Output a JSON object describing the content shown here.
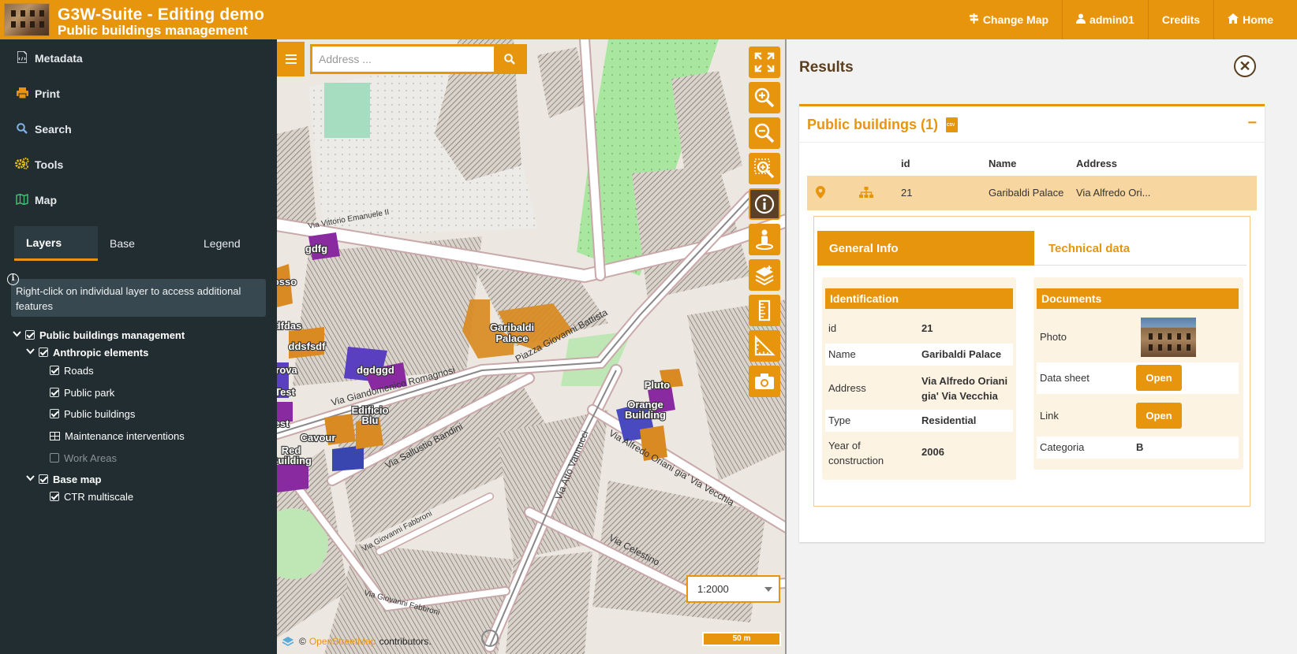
{
  "header": {
    "title": "G3W-Suite - Editing demo",
    "subtitle": "Public buildings management",
    "nav": [
      {
        "label": "Change Map",
        "icon": "signpost-icon"
      },
      {
        "label": "admin01",
        "icon": "user-icon"
      },
      {
        "label": "Credits",
        "icon": ""
      },
      {
        "label": "Home",
        "icon": "home-icon"
      }
    ]
  },
  "sidebar": {
    "menu": [
      {
        "label": "Metadata",
        "icon": "file-code-icon"
      },
      {
        "label": "Print",
        "icon": "print-icon"
      },
      {
        "label": "Search",
        "icon": "search-icon"
      },
      {
        "label": "Tools",
        "icon": "cogs-icon"
      },
      {
        "label": "Map",
        "icon": "map-icon"
      }
    ],
    "tabs": [
      "Layers",
      "Base",
      "Legend"
    ],
    "active_tab": "Layers",
    "info": "Right-click on individual layer to access additional features",
    "tree": [
      {
        "label": "Public buildings management",
        "level": 0,
        "group": true,
        "checked": true
      },
      {
        "label": "Anthropic elements",
        "level": 1,
        "group": true,
        "checked": true
      },
      {
        "label": "Roads",
        "level": 2,
        "checked": true
      },
      {
        "label": "Public park",
        "level": 2,
        "checked": true
      },
      {
        "label": "Public buildings",
        "level": 2,
        "checked": true
      },
      {
        "label": "Maintenance interventions",
        "level": 2,
        "table": true
      },
      {
        "label": "Work Areas",
        "level": 2,
        "checked": false
      },
      {
        "label": "Base map",
        "level": 1,
        "group": true,
        "checked": true
      },
      {
        "label": "CTR multiscale",
        "level": 2,
        "checked": true
      }
    ]
  },
  "map": {
    "search_placeholder": "Address ...",
    "scale": "1:2000",
    "scalebar": "50 m",
    "attribution_prefix": "©",
    "attribution_link": "OpenStreetMap",
    "attribution_suffix": "contributors.",
    "labels": {
      "garibaldi": "Garibaldi Palace",
      "pluto": "Pluto",
      "orange": "Orange Building",
      "edificio": "Edificio Blu",
      "cavour": "Cavour",
      "red": "Red Building",
      "gdfg": "gdfg",
      "dgdggd": "dgdggd",
      "ddsfsdf": "ddsfsdf",
      "dfdas": "dfdas",
      "osso": "osso",
      "rova": "rova",
      "test": "Test",
      "est": "est",
      "via_giandomenico": "Via Giandomenico Romagnosi",
      "via_sallustio": "Via Sallustio Bandini",
      "piazza_giovanni": "Piazza Giovanni Battista",
      "via_alfredo": "Via Alfredo Oriani gia' Via Vecchia",
      "via_vittorio": "Via Vittorio Emanuele II",
      "via_atto": "Via Atto Vannucci",
      "via_celestino": "Via Celestino",
      "via_giovanni_fabbroni": "Via Giovanni Fabbroni",
      "via_giovanni_sabbroni": "Via Giovanni Fabbroni"
    },
    "tools": [
      {
        "name": "fullscreen-icon",
        "active": false
      },
      {
        "name": "zoom-in-icon",
        "active": false
      },
      {
        "name": "zoom-out-icon",
        "active": false
      },
      {
        "name": "zoom-box-icon",
        "active": false
      },
      {
        "name": "info-icon",
        "active": true
      },
      {
        "name": "streetview-icon",
        "active": false
      },
      {
        "name": "layers-icon",
        "active": false
      },
      {
        "name": "measure-length-icon",
        "active": false
      },
      {
        "name": "measure-area-icon",
        "active": false
      },
      {
        "name": "camera-icon",
        "active": false
      }
    ]
  },
  "results": {
    "title": "Results",
    "layer_title": "Public buildings (1)",
    "columns": [
      "id",
      "Name",
      "Address"
    ],
    "row": {
      "id": "21",
      "name": "Garibaldi Palace",
      "address": "Via Alfredo Ori..."
    },
    "tabs": [
      "General Info",
      "Technical data"
    ],
    "identification": {
      "title": "Identification",
      "fields": [
        {
          "label": "id",
          "value": "21"
        },
        {
          "label": "Name",
          "value": "Garibaldi Palace"
        },
        {
          "label": "Address",
          "value": "Via Alfredo Oriani gia' Via Vecchia"
        },
        {
          "label": "Type",
          "value": "Residential"
        },
        {
          "label": "Year of construction",
          "value": "2006"
        }
      ]
    },
    "documents": {
      "title": "Documents",
      "photo_label": "Photo",
      "datasheet_label": "Data sheet",
      "link_label": "Link",
      "open_label": "Open",
      "categoria_label": "Categoria",
      "categoria_value": "B"
    }
  },
  "colors": {
    "accent": "#e8950e",
    "sidebar": "#222d32",
    "selected_row": "#f8d69f",
    "dark_brown": "#5a3e1e"
  }
}
